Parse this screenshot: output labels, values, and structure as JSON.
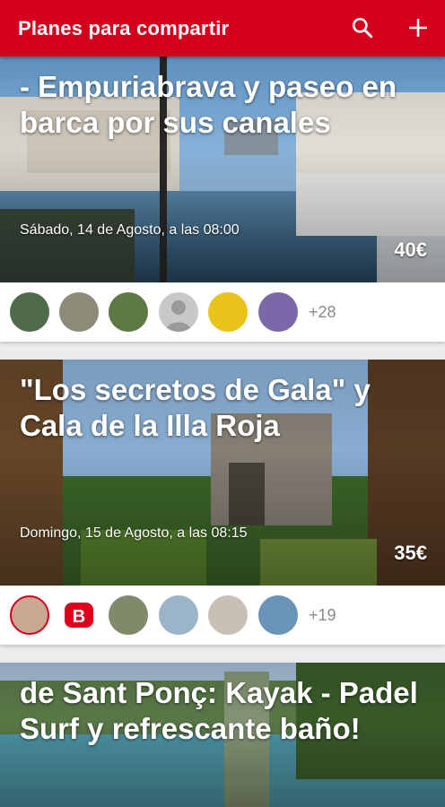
{
  "appbar": {
    "title": "Planes para compartir",
    "search_icon": "search-icon",
    "add_icon": "plus-icon",
    "color": "#d5001c"
  },
  "plans": [
    {
      "title": "- Empuriabrava y paseo en barca por sus canales",
      "date": "Sábado, 14 de Agosto, a las 08:00",
      "price": "40€",
      "more_attendees": "+28"
    },
    {
      "title": "\"Los secretos de Gala\" y Cala de la Illa Roja",
      "date": "Domingo, 15 de Agosto, a las 08:15",
      "price": "35€",
      "more_attendees": "+19"
    },
    {
      "title": "de Sant Ponç: Kayak - Padel Surf y refrescante baño!"
    }
  ]
}
